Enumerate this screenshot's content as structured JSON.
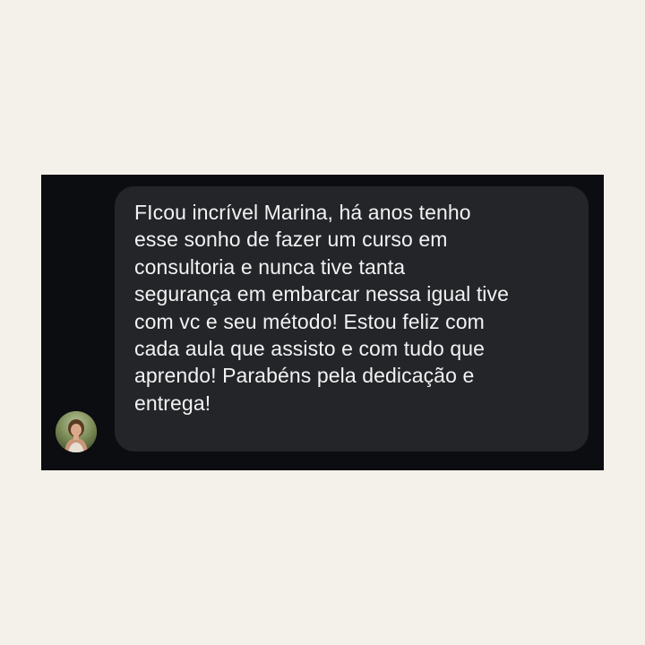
{
  "message": {
    "lines": [
      "FIcou incrível Marina, há anos tenho",
      "esse sonho de fazer um curso em",
      "consultoria e nunca tive tanta",
      "segurança em embarcar nessa igual tive",
      "com vc e seu método! Estou feliz com",
      "cada aula que assisto e com tudo que",
      "aprendo! Parabéns pela dedicação e",
      "entrega!"
    ]
  },
  "colors": {
    "page_background": "#f4f0ea",
    "chat_background": "#0b0d10",
    "bubble_background": "#232529",
    "text": "#f2f2f2"
  }
}
